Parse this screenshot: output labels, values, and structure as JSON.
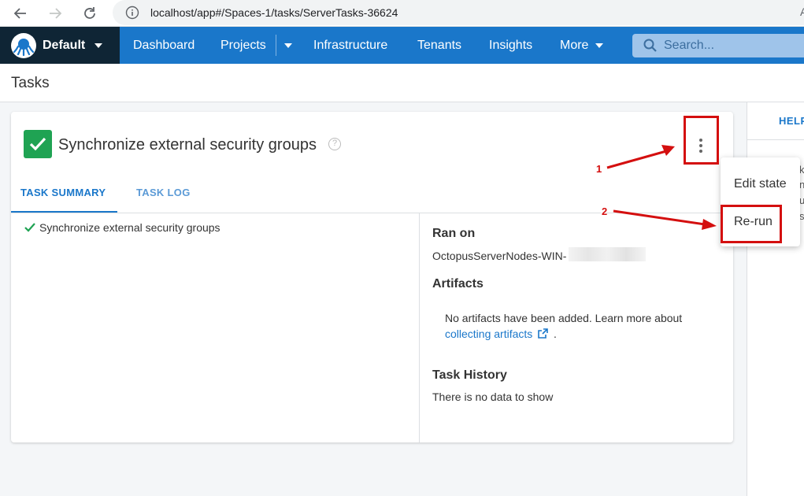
{
  "browser": {
    "url": "localhost/app#/Spaces-1/tasks/ServerTasks-36624",
    "trail_fragment": "A",
    "back_icon": "arrow-left-icon",
    "forward_icon": "arrow-right-icon",
    "refresh_icon": "refresh-icon",
    "info_icon": "info-icon"
  },
  "header": {
    "space_name": "Default",
    "nav": {
      "dashboard": "Dashboard",
      "projects": "Projects",
      "infrastructure": "Infrastructure",
      "tenants": "Tenants",
      "insights": "Insights",
      "more": "More"
    },
    "search_placeholder": "Search...",
    "colors": {
      "space_bg": "#0f2535",
      "nav_bg": "#1a77ca"
    }
  },
  "page": {
    "title": "Tasks"
  },
  "task": {
    "title": "Synchronize external security groups",
    "status_color": "#1fa353",
    "tabs": {
      "summary": "TASK SUMMARY",
      "log": "TASK LOG"
    },
    "summary_item": "Synchronize external security groups",
    "ran_on_heading": "Ran on",
    "ran_on_value": "OctopusServerNodes-WIN-",
    "artifacts_heading": "Artifacts",
    "artifacts_text": "No artifacts have been added. Learn more about",
    "artifacts_link": "collecting artifacts",
    "artifacts_tail": ".",
    "history_heading": "Task History",
    "history_text": "There is no data to show"
  },
  "help": {
    "tab": "HELP",
    "fragments": [
      "k",
      "n",
      "u",
      "s"
    ]
  },
  "menu": {
    "items": [
      "Edit state",
      "Re-run"
    ]
  },
  "annotations": {
    "labels": [
      "1",
      "2"
    ],
    "color": "#d40f0f"
  }
}
